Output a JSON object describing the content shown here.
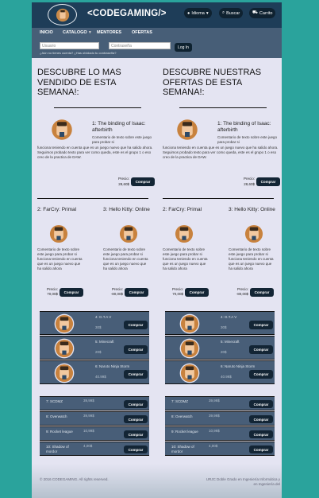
{
  "header": {
    "title": "<CODEGAMING/>",
    "buttons": {
      "language": "Idioma",
      "search": "Buscar",
      "cart": "Carrito"
    }
  },
  "nav": {
    "items": [
      "INICIO",
      "CATALOGO",
      "MENTORES",
      "OFERTAS"
    ]
  },
  "login": {
    "username_placeholder": "Usuario",
    "password_placeholder": "Contraseña",
    "button": "Log In",
    "hint": "¿Aún no tienes cuenta? ¿Has olvidado tu contraseña?"
  },
  "best_sellers": {
    "title": "DESCUBRE LO MAS VENDIDO DE ESTA SEMANA!:",
    "featured": {
      "title": "1: The binding of Isaac: afterbirth",
      "desc_a": "Comentario de texto sobre este juego para probar si",
      "desc_b": "funciona teniendo en cuenta que es un juego nuevo que ha salido ahora. Seguimos probado texto para ver como queda, este es el grupo 1 o eso creo de la practica de DAW.",
      "price_label": "Precio:",
      "price": "28,60$",
      "buy": "Comprar"
    },
    "small": [
      {
        "title": "2: FarCry: Primal",
        "desc": "Comentario de texto sobre este juego para probar si funciona teniendo en cuenta que es un juego nuevo que ha salido ahora",
        "price_label": "Precio:",
        "price": "70,00$",
        "buy": "Comprar"
      },
      {
        "title": "3: Hello Kitty: Online",
        "desc": "Comentario de texto sobre este juego para probar si funciona teniendo en cuenta que es un juego nuevo que ha salido ahora",
        "price_label": "Precio:",
        "price": "-80,00$",
        "buy": "Comprar"
      }
    ],
    "rows": [
      {
        "title": "4: G.T.A V",
        "price": "30$",
        "buy": "Comprar"
      },
      {
        "title": "5: Minecraft",
        "price": "20$",
        "buy": "Comprar"
      },
      {
        "title": "6: Naruto Ninja Storm",
        "price": "40.99$",
        "buy": "Comprar"
      }
    ],
    "rows2": [
      {
        "title": "7: SCDMZ",
        "price": "39,99$",
        "buy": "Comprar"
      },
      {
        "title": "8: Overwatch",
        "price": "39,99$",
        "buy": "Comprar"
      },
      {
        "title": "9: Rocket league",
        "price": "10,99$",
        "buy": "Comprar"
      },
      {
        "title": "10: Shadow of mordor",
        "price": "4,00$",
        "buy": "Comprar"
      }
    ]
  },
  "offers": {
    "title": "DESCUBRE NUESTRAS OFERTAS DE ESTA SEMANA!:",
    "featured": {
      "title": "1: The binding of Isaac: afterbirth",
      "desc_a": "Comentario de texto sobre este juego para probar si",
      "desc_b": "funciona teniendo en cuenta que es un juego nuevo que ha salido ahora. Seguimos probado texto para ver como queda, este es el grupo 1 o eso creo de la practica de DAW.",
      "price_label": "Precio:",
      "price": "28,60$",
      "buy": "Comprar"
    },
    "small": [
      {
        "title": "2: FarCry: Primal",
        "desc": "Comentario de texto sobre este juego para probar si funciona teniendo en cuenta que es un juego nuevo que ha salido ahora",
        "price_label": "Precio:",
        "price": "70,00$",
        "buy": "Comprar"
      },
      {
        "title": "3: Hello Kitty: Online",
        "desc": "Comentario de texto sobre este juego para probar si funciona teniendo en cuenta que es un juego nuevo que ha salido ahora",
        "price_label": "Precio:",
        "price": "-80,00$",
        "buy": "Comprar"
      }
    ],
    "rows": [
      {
        "title": "4: G.T.A V",
        "price": "30$",
        "buy": "Comprar"
      },
      {
        "title": "5: Minecraft",
        "price": "20$",
        "buy": "Comprar"
      },
      {
        "title": "6: Naruto Ninja Storm",
        "price": "40.99$",
        "buy": "Comprar"
      }
    ],
    "rows2": [
      {
        "title": "7: SCDMZ",
        "price": "39,99$",
        "buy": "Comprar"
      },
      {
        "title": "8: Overwatch",
        "price": "39,99$",
        "buy": "Comprar"
      },
      {
        "title": "9: Rocket league",
        "price": "10,99$",
        "buy": "Comprar"
      },
      {
        "title": "10: Shadow of mordor",
        "price": "4,00$",
        "buy": "Comprar"
      }
    ]
  },
  "footer": {
    "left": "© 2016 CODEGAMING. All rights reserved.",
    "right": "URJC Doble Grado en Ingeniería Informática y en Ingeniería del"
  },
  "colors": {
    "page_bg": "#2aa39c",
    "header": "#1e3d58",
    "nav": "#475e77",
    "content_bg": "#e4e4f2",
    "row_bg": "#485e78",
    "button": "#132535"
  }
}
